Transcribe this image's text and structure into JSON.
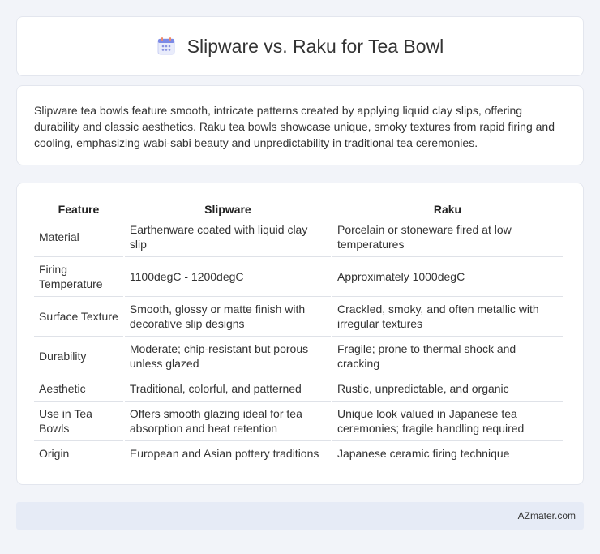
{
  "header": {
    "title": "Slipware vs. Raku for Tea Bowl",
    "icon": "calendar-icon"
  },
  "intro": {
    "text": "Slipware tea bowls feature smooth, intricate patterns created by applying liquid clay slips, offering durability and classic aesthetics. Raku tea bowls showcase unique, smoky textures from rapid firing and cooling, emphasizing wabi-sabi beauty and unpredictability in traditional tea ceremonies."
  },
  "table": {
    "headers": [
      "Feature",
      "Slipware",
      "Raku"
    ],
    "rows": [
      [
        "Material",
        "Earthenware coated with liquid clay slip",
        "Porcelain or stoneware fired at low temperatures"
      ],
      [
        "Firing Temperature",
        "1100degC - 1200degC",
        "Approximately 1000degC"
      ],
      [
        "Surface Texture",
        "Smooth, glossy or matte finish with decorative slip designs",
        "Crackled, smoky, and often metallic with irregular textures"
      ],
      [
        "Durability",
        "Moderate; chip-resistant but porous unless glazed",
        "Fragile; prone to thermal shock and cracking"
      ],
      [
        "Aesthetic",
        "Traditional, colorful, and patterned",
        "Rustic, unpredictable, and organic"
      ],
      [
        "Use in Tea Bowls",
        "Offers smooth glazing ideal for tea absorption and heat retention",
        "Unique look valued in Japanese tea ceremonies; fragile handling required"
      ],
      [
        "Origin",
        "European and Asian pottery traditions",
        "Japanese ceramic firing technique"
      ]
    ]
  },
  "footer": {
    "brand": "AZmater.com"
  }
}
